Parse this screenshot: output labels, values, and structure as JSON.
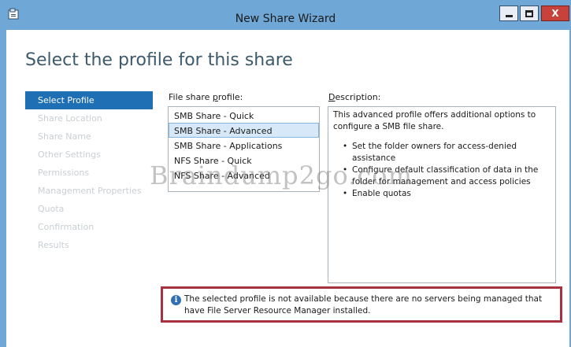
{
  "window": {
    "title": "New Share Wizard",
    "controls": {
      "minimize_icon": "minimize-icon",
      "maximize_icon": "maximize-icon",
      "close_label": "X"
    }
  },
  "page": {
    "heading": "Select the profile for this share"
  },
  "nav": {
    "items": [
      {
        "label": "Select Profile",
        "active": true
      },
      {
        "label": "Share Location",
        "active": false
      },
      {
        "label": "Share Name",
        "active": false
      },
      {
        "label": "Other Settings",
        "active": false
      },
      {
        "label": "Permissions",
        "active": false
      },
      {
        "label": "Management Properties",
        "active": false
      },
      {
        "label": "Quota",
        "active": false
      },
      {
        "label": "Confirmation",
        "active": false
      },
      {
        "label": "Results",
        "active": false
      }
    ]
  },
  "profile": {
    "label_prefix": "File share ",
    "label_accel": "p",
    "label_suffix": "rofile:",
    "items": [
      {
        "label": "SMB Share - Quick",
        "selected": false
      },
      {
        "label": "SMB Share - Advanced",
        "selected": true
      },
      {
        "label": "SMB Share - Applications",
        "selected": false
      },
      {
        "label": "NFS Share - Quick",
        "selected": false
      },
      {
        "label": "NFS Share - Advanced",
        "selected": false
      }
    ]
  },
  "description": {
    "label_accel": "D",
    "label_suffix": "escription:",
    "intro": "This advanced profile offers additional options to configure a SMB file share.",
    "bullets": [
      "Set the folder owners for access-denied assistance",
      "Configure default classification of data in the folder for management and access policies",
      "Enable quotas"
    ]
  },
  "watermark": "Braindump2go.com",
  "alert": {
    "icon": "info-icon",
    "text": "The selected profile is not available because there are no servers being managed that have File Server Resource Manager installed."
  },
  "colors": {
    "titlebar": "#6fa8d6",
    "nav_active": "#1f6fb5",
    "alert_border": "#a8323f",
    "close_button": "#c8423c"
  }
}
